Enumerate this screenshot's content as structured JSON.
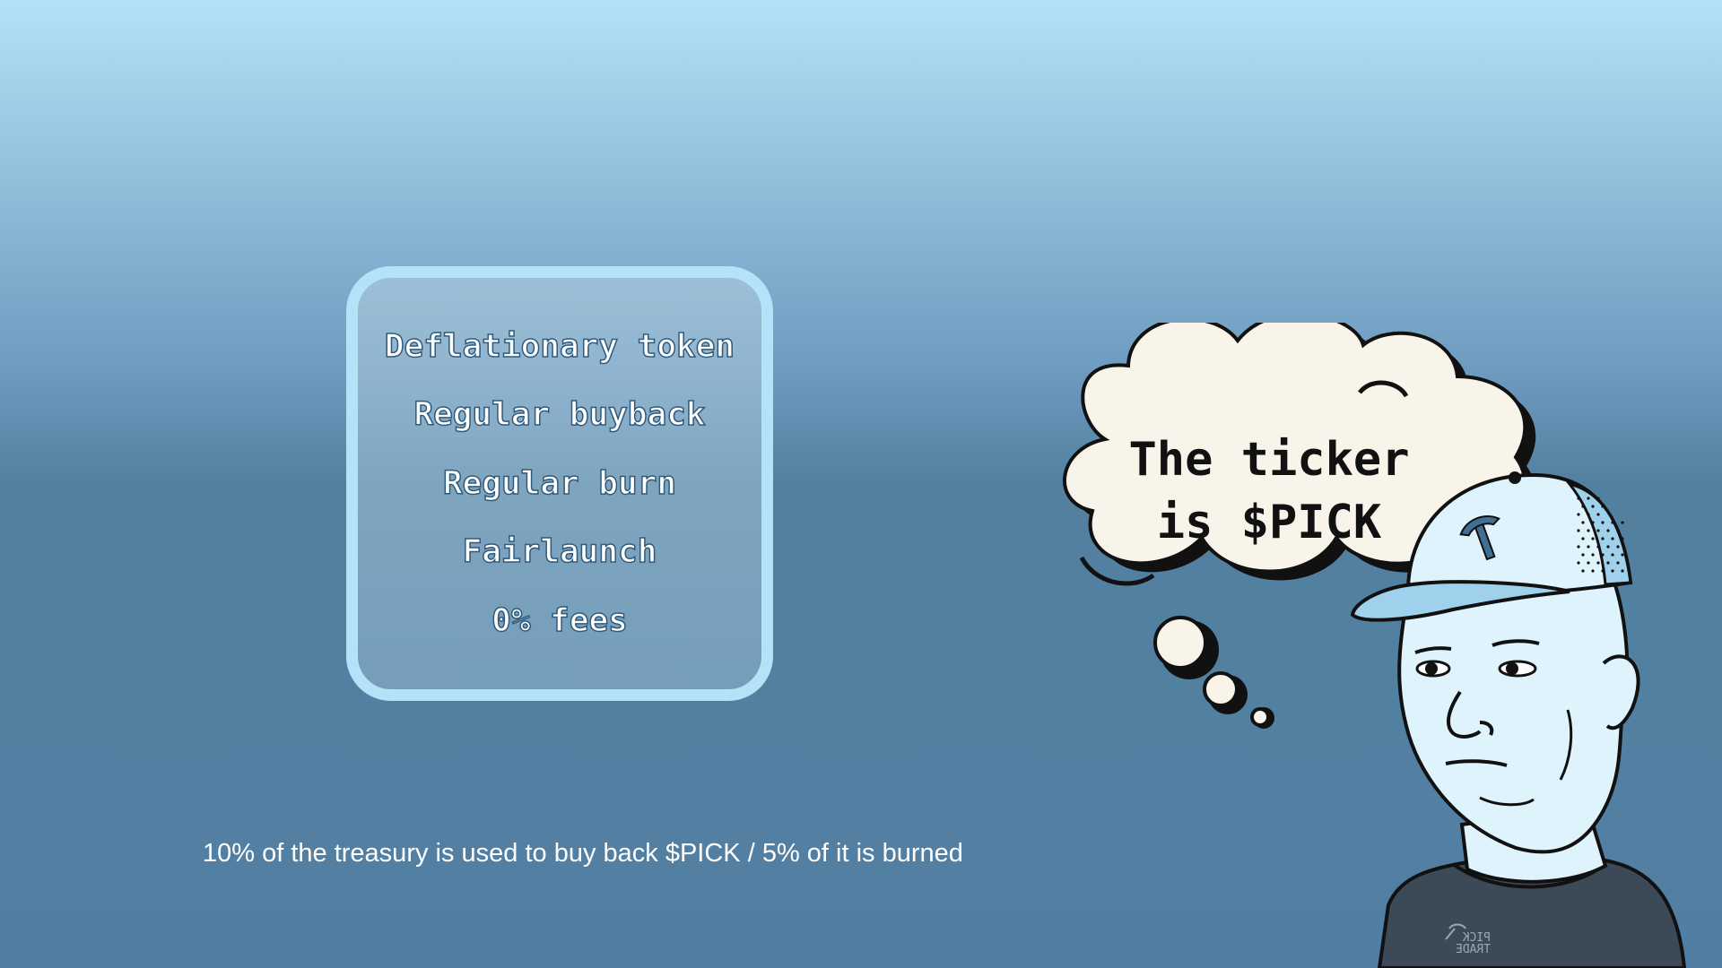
{
  "features": {
    "items": [
      "Deflationary token",
      "Regular buyback",
      "Regular burn",
      "Fairlaunch",
      "0% fees"
    ]
  },
  "caption": "10% of the treasury is used to buy back $PICK / 5% of it is burned",
  "thought_bubble": {
    "line1": "The ticker",
    "line2": "is $PICK"
  },
  "shirt_logo": {
    "line1": "PICK",
    "line2": "TRADE"
  },
  "colors": {
    "card_border": "#b4e2f8",
    "bubble_fill": "#f8f4ea",
    "face_fill": "#dff3fd",
    "shirt_fill": "#3c4a57",
    "outline": "#111111"
  },
  "icons": {
    "cap_logo": "pickaxe-icon"
  }
}
